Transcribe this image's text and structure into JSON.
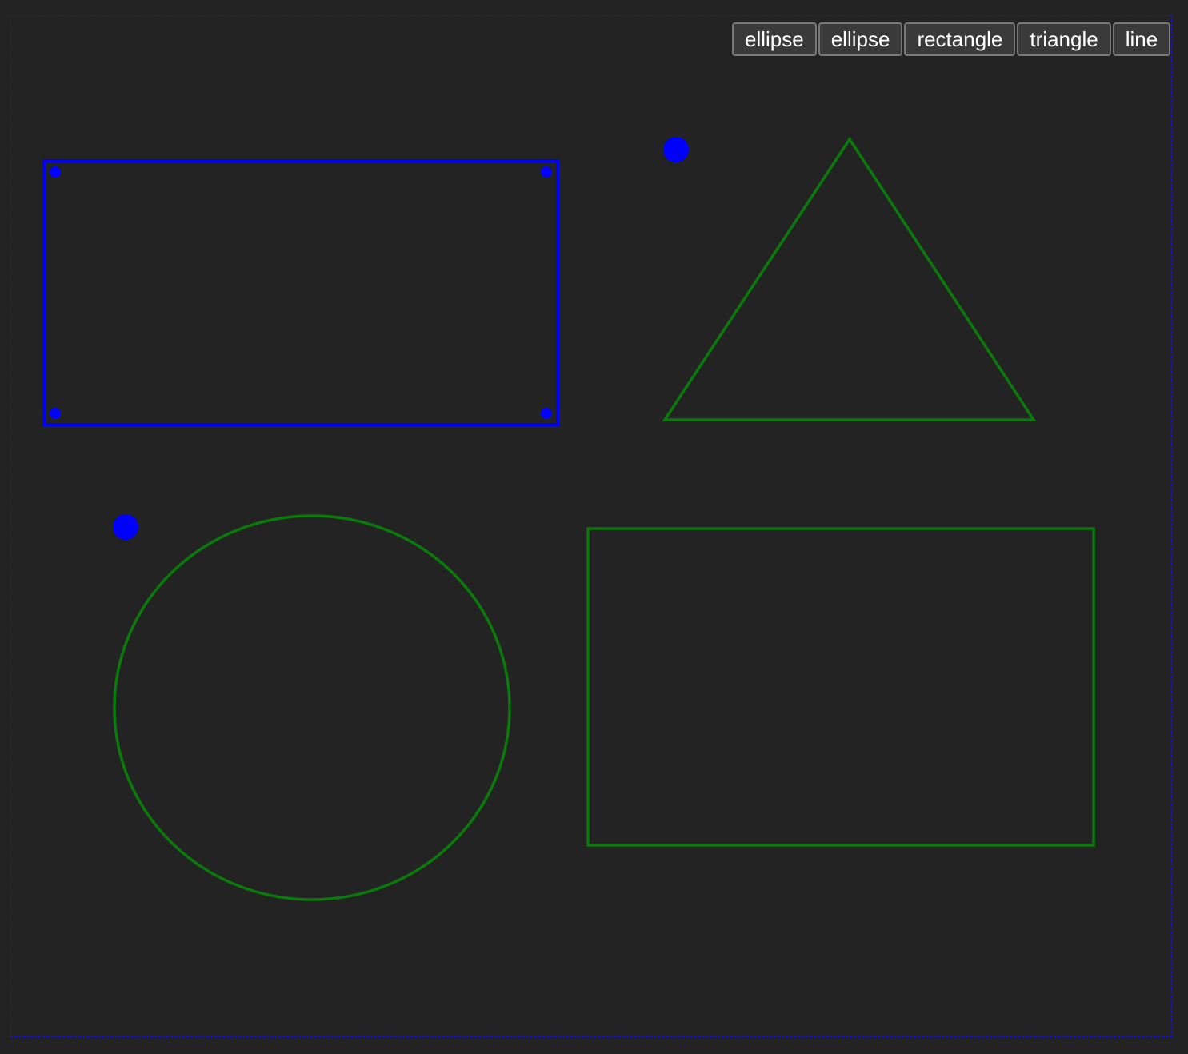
{
  "toolbar": {
    "buttons": [
      {
        "label": "ellipse"
      },
      {
        "label": "ellipse"
      },
      {
        "label": "rectangle"
      },
      {
        "label": "triangle"
      },
      {
        "label": "line"
      }
    ]
  },
  "colors": {
    "background": "#232323",
    "selected_stroke": "#0000ff",
    "shape_stroke": "#0a7a0a",
    "handle": "#0000ff",
    "stage_border": "#1414d2"
  },
  "canvas": {
    "shapes": [
      {
        "type": "rectangle",
        "selected": true
      },
      {
        "type": "triangle",
        "selected": false
      },
      {
        "type": "ellipse",
        "selected": false
      },
      {
        "type": "rectangle",
        "selected": false
      }
    ]
  }
}
